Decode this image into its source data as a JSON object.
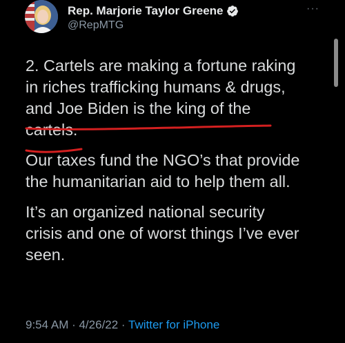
{
  "author": {
    "display_name": "Rep. Marjorie Taylor Greene",
    "handle": "@RepMTG",
    "verified_icon": "verified-badge-icon",
    "more_icon": "more-options-icon"
  },
  "tweet": {
    "lines_p1": [
      "2. Cartels are making a fortune raking",
      "in riches trafficking humans & drugs,",
      "and Joe Biden is the king of the",
      "cartels."
    ],
    "lines_p2": [
      "Our taxes fund the NGO’s that provide",
      "the humanitarian aid to help them all."
    ],
    "lines_p3": [
      "It’s an organized national security",
      "crisis and one of worst things I’ve ever",
      "seen."
    ],
    "timestamp": "9:54 AM · 4/26/22 · ",
    "source": "Twitter for iPhone"
  },
  "colors": {
    "background": "#000000",
    "text": "#d9dbdc",
    "secondary": "#8b98a5",
    "link": "#1d9bf0",
    "annotation": "#d42020"
  }
}
